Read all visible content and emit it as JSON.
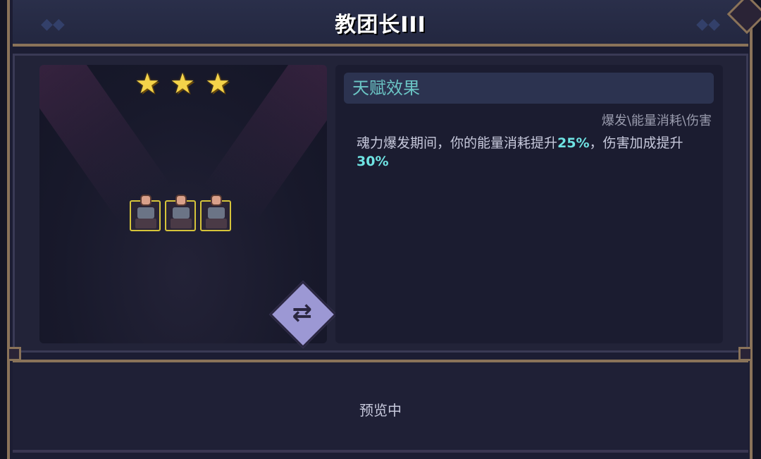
{
  "header": {
    "title": "教团长III"
  },
  "character": {
    "stars": [
      "★",
      "★",
      "★"
    ],
    "stars_count": 3,
    "units": [
      "figure",
      "figure",
      "figure"
    ],
    "swap_icon": "swap-icon"
  },
  "talent": {
    "title": "天赋效果",
    "tags": "爆发\\能量消耗\\伤害",
    "desc_part1": "魂力爆发期间，你的能量消耗提升",
    "value1": "25%",
    "desc_part2": "，伤害加成提升",
    "value2": "30%"
  },
  "footer": {
    "status": "预览中"
  },
  "colors": {
    "accent": "#6fe3e3",
    "frame": "#8a7359",
    "star": "#f4d34a"
  }
}
